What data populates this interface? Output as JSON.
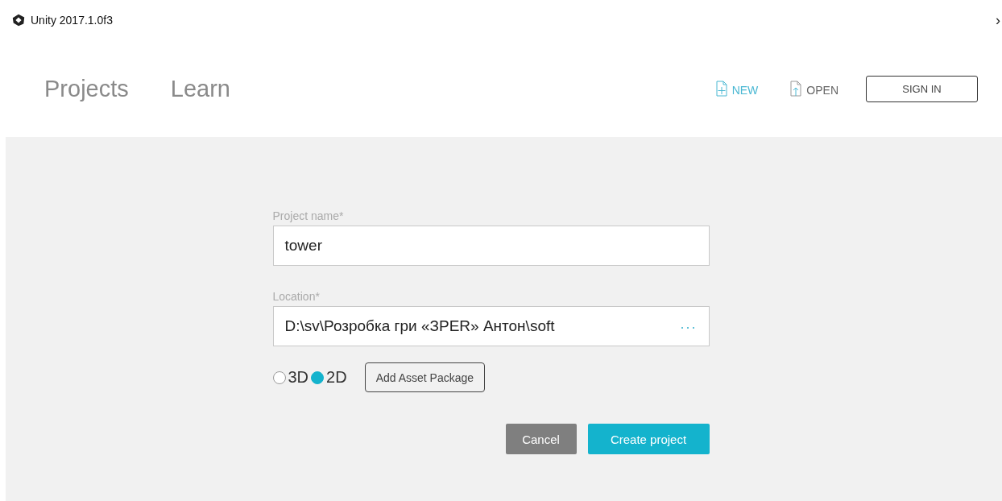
{
  "window": {
    "title": "Unity 2017.1.0f3",
    "overflow_glyph": "›"
  },
  "tabs": [
    {
      "label": "Projects",
      "selected": false
    },
    {
      "label": "Learn",
      "selected": false
    }
  ],
  "actions": [
    {
      "kind": "new",
      "label": "NEW",
      "selected": true
    },
    {
      "kind": "open",
      "label": "OPEN",
      "selected": false
    }
  ],
  "sign_in": {
    "label": "SIGN IN"
  },
  "form": {
    "project_name": {
      "label": "Project name*",
      "value": "tower"
    },
    "location": {
      "label": "Location*",
      "value": "D:\\sv\\Розробка гри «ЗPER» Антон\\soft",
      "browse": "..."
    },
    "modes": [
      {
        "label": "3D",
        "selected": false
      },
      {
        "label": "2D",
        "selected": true
      }
    ],
    "add_asset": "Add Asset Package",
    "cancel": "Cancel",
    "create": "Create project"
  }
}
